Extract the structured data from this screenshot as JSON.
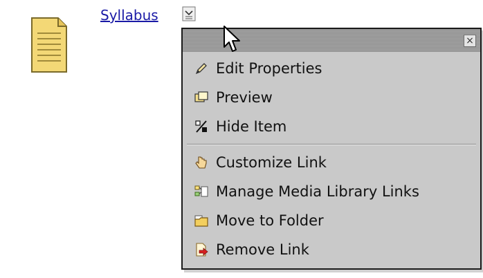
{
  "item": {
    "title": "Syllabus",
    "icon": "document-icon",
    "menu_toggle_icon": "context-menu-icon"
  },
  "context_menu": {
    "close_label": "×",
    "groups": [
      [
        {
          "label": "Edit Properties",
          "icon": "pencil-icon"
        },
        {
          "label": "Preview",
          "icon": "preview-icon"
        },
        {
          "label": "Hide Item",
          "icon": "hide-item-icon"
        }
      ],
      [
        {
          "label": "Customize Link",
          "icon": "customize-link-icon"
        },
        {
          "label": "Manage Media Library Links",
          "icon": "media-library-icon"
        },
        {
          "label": "Move to Folder",
          "icon": "folder-move-icon"
        },
        {
          "label": "Remove Link",
          "icon": "remove-link-icon"
        }
      ]
    ]
  },
  "colors": {
    "link": "#1a1aa6",
    "menu_bg": "#c9c9c9",
    "menu_border": "#1a1a1a"
  }
}
